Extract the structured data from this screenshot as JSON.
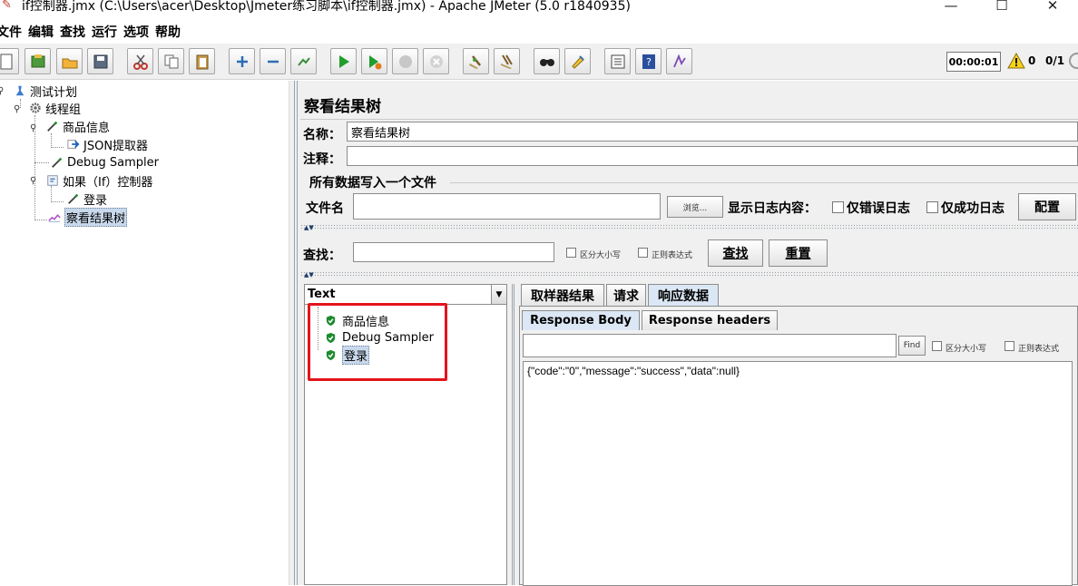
{
  "window": {
    "title": "if控制器.jmx (C:\\Users\\acer\\Desktop\\Jmeter练习脚本\\if控制器.jmx) - Apache JMeter (5.0 r1840935)",
    "minimize": "—",
    "maximize": "☐",
    "close": "✕"
  },
  "menu": [
    "文件",
    "编辑",
    "查找",
    "运行",
    "选项",
    "帮助"
  ],
  "toolbar": {
    "timer": "00:00:01",
    "warnings": "0",
    "threads": "0/1",
    "icons": [
      "new-icon",
      "templates-icon",
      "open-icon",
      "save-icon",
      "cut-icon",
      "copy-icon",
      "paste-icon",
      "expand-icon",
      "collapse-icon",
      "toggle-icon",
      "start-icon",
      "start-no-pause-icon",
      "stop-icon",
      "shutdown-icon",
      "clear-icon",
      "clear-all-icon",
      "search-icon",
      "reset-search-icon",
      "function-helper-icon",
      "help-icon",
      "logger-icon"
    ]
  },
  "tree": {
    "items": [
      {
        "label": "测试计划",
        "icon": "test-plan-icon",
        "level": 0
      },
      {
        "label": "线程组",
        "icon": "thread-group-icon",
        "level": 1
      },
      {
        "label": "商品信息",
        "icon": "sampler-icon",
        "level": 2
      },
      {
        "label": "JSON提取器",
        "icon": "extractor-icon",
        "level": 3
      },
      {
        "label": "Debug Sampler",
        "icon": "sampler-icon",
        "level": 2
      },
      {
        "label": "如果（If）控制器",
        "icon": "if-controller-icon",
        "level": 2
      },
      {
        "label": "登录",
        "icon": "sampler-icon",
        "level": 3
      },
      {
        "label": "察看结果树",
        "icon": "listener-icon",
        "level": 2,
        "selected": true
      }
    ]
  },
  "panel": {
    "title": "察看结果树",
    "name_label": "名称：",
    "name_value": "察看结果树",
    "comment_label": "注释：",
    "comment_value": "",
    "file_group_title": "所有数据写入一个文件",
    "filename_label": "文件名",
    "filename_value": "",
    "browse_button": "浏览...",
    "log_content_label": "显示日志内容：",
    "errors_only": "仅错误日志",
    "success_only": "仅成功日志",
    "configure_button": "配置",
    "search_label": "查找：",
    "search_value": "",
    "case_sensitive": "区分大小写",
    "regex": "正则表达式",
    "search_button": "查找",
    "reset_button": "重置"
  },
  "results": {
    "renderer": "Text",
    "items": [
      {
        "label": "商品信息",
        "status": "success"
      },
      {
        "label": "Debug Sampler",
        "status": "success"
      },
      {
        "label": "登录",
        "status": "success",
        "selected": true
      }
    ]
  },
  "tabs": {
    "main": [
      "取样器结果",
      "请求",
      "响应数据"
    ],
    "active_main": "响应数据",
    "sub": [
      "Response Body",
      "Response headers"
    ],
    "active_sub": "Response Body",
    "find_button": "Find",
    "case_sensitive": "区分大小写",
    "regex": "正则表达式",
    "response_body": "{\"code\":\"0\",\"message\":\"success\",\"data\":null}"
  },
  "colors": {
    "highlight_border": "#e3141b",
    "selection": "#c9d9ec",
    "success_green": "#1e8a2e"
  }
}
